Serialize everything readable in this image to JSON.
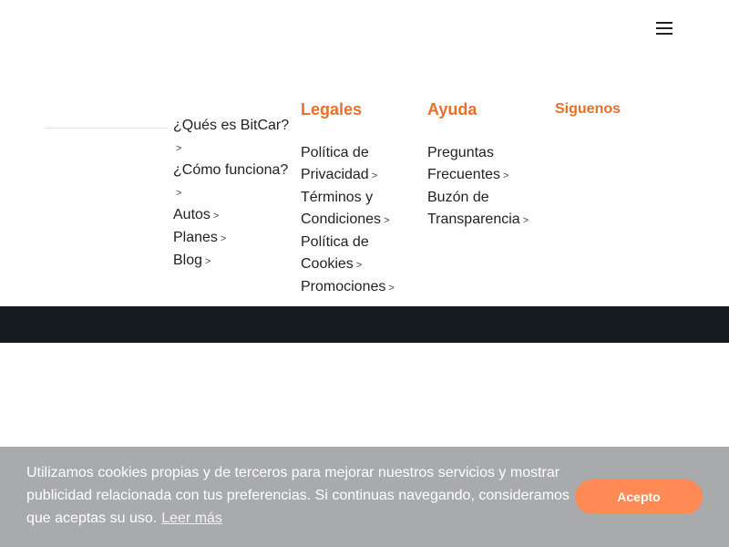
{
  "header": {
    "menu_icon": "hamburger-icon"
  },
  "footer": {
    "col1": {
      "links": [
        {
          "label": "¿Qués es BitCar?",
          "chev": ">"
        },
        {
          "label": "¿Cómo funciona?",
          "chev": ">"
        },
        {
          "label": "Autos",
          "chev": ">"
        },
        {
          "label": "Planes",
          "chev": ">"
        },
        {
          "label": "Blog",
          "chev": ">"
        }
      ]
    },
    "col2": {
      "title": "Legales",
      "links": [
        {
          "label": "Política de Privacidad",
          "chev": ">"
        },
        {
          "label": "Términos y Condiciones",
          "chev": ">"
        },
        {
          "label": "Política de Cookies",
          "chev": ">"
        },
        {
          "label": "Promociones",
          "chev": ">"
        }
      ]
    },
    "col3": {
      "title": "Ayuda",
      "links": [
        {
          "label": "Preguntas Frecuentes",
          "chev": ">"
        },
        {
          "label": "Buzón de Transparencia",
          "chev": ">"
        }
      ]
    },
    "col4": {
      "title": "Siguenos"
    }
  },
  "cookie_banner": {
    "text": "Utilizamos cookies propias y de terceros para mejorar nuestros servicios y mostrar publicidad relacionada con tus preferencias. Si continuas navegando, consideramos que aceptas su uso.",
    "learn_more": "Leer más",
    "accept_label": "Acepto"
  },
  "colors": {
    "accent": "#e8702a",
    "dark_band": "#141b20",
    "banner_bg": "#a8aaab",
    "button_bg": "#ff8a55"
  }
}
